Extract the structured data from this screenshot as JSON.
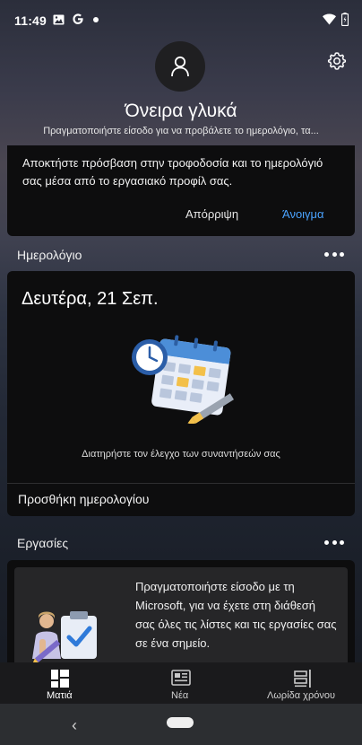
{
  "status_bar": {
    "time": "11:49",
    "icons": [
      "gallery-icon",
      "google-g-icon",
      "notification-dot-icon",
      "wifi-icon",
      "battery-icon"
    ]
  },
  "header": {
    "greeting": "Όνειρα γλυκά",
    "subtitle": "Πραγματοποιήστε είσοδο για να προβάλετε το ημερολόγιο, τα..."
  },
  "notice": {
    "text": "Αποκτήστε πρόσβαση στην τροφοδοσία και το ημερολόγιό σας μέσα από το εργασιακό προφίλ σας.",
    "dismiss_label": "Απόρριψη",
    "open_label": "Άνοιγμα",
    "open_color": "#4aa3ff"
  },
  "calendar": {
    "section_title": "Ημερολόγιο",
    "date": "Δευτέρα, 21 Σεπ.",
    "description": "Διατηρήστε τον έλεγχο των συναντήσεών σας",
    "add_label": "Προσθήκη ημερολογίου"
  },
  "tasks": {
    "section_title": "Εργασίες",
    "text": "Πραγματοποιήστε είσοδο με τη Microsoft, για να έχετε στη διάθεσή σας όλες τις λίστες και τις εργασίες σας σε ένα σημείο."
  },
  "bottom_nav": {
    "items": [
      {
        "label": "Ματιά",
        "icon": "glance-icon",
        "active": true
      },
      {
        "label": "Νέα",
        "icon": "news-icon",
        "active": false
      },
      {
        "label": "Λωρίδα χρόνου",
        "icon": "timeline-icon",
        "active": false
      }
    ]
  },
  "system_nav": {
    "back_glyph": "‹"
  }
}
